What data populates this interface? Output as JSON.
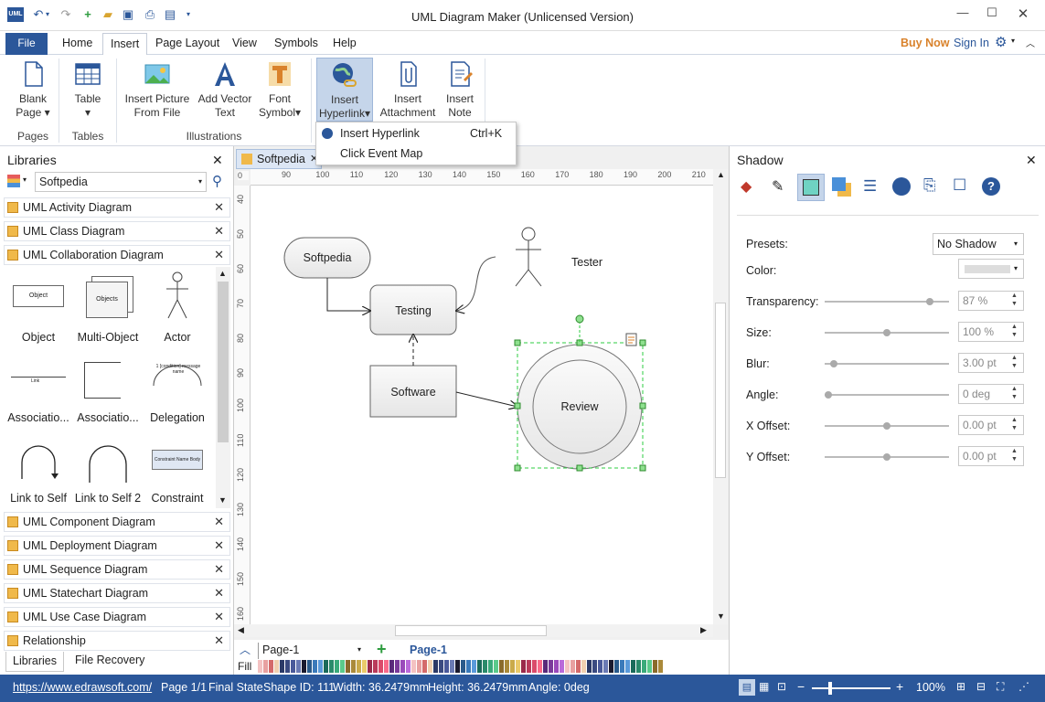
{
  "app": {
    "title": "UML Diagram Maker (Unlicensed Version)"
  },
  "menu": {
    "file": "File",
    "tabs": [
      "Home",
      "Insert",
      "Page Layout",
      "View",
      "Symbols",
      "Help"
    ],
    "buy_now": "Buy Now",
    "sign_in": "Sign In"
  },
  "ribbon": {
    "buttons": [
      {
        "line1": "Blank",
        "line2": "Page ▾"
      },
      {
        "line1": "Table",
        "line2": "▾"
      },
      {
        "line1": "Insert Picture",
        "line2": "From File"
      },
      {
        "line1": "Add Vector",
        "line2": "Text"
      },
      {
        "line1": "Font",
        "line2": "Symbol▾"
      },
      {
        "line1": "Insert",
        "line2": "Hyperlink▾"
      },
      {
        "line1": "Insert",
        "line2": "Attachment"
      },
      {
        "line1": "Insert",
        "line2": "Note"
      }
    ],
    "groups": [
      "Pages",
      "Tables",
      "Illustrations"
    ]
  },
  "hyperlink_menu": {
    "items": [
      {
        "label": "Insert Hyperlink",
        "shortcut": "Ctrl+K"
      },
      {
        "label": "Click Event Map",
        "shortcut": ""
      }
    ]
  },
  "libraries": {
    "title": "Libraries",
    "search_value": "Softpedia",
    "open": [
      "UML Activity Diagram",
      "UML Class Diagram",
      "UML Collaboration Diagram"
    ],
    "shapes": [
      "Object",
      "Multi-Object",
      "Actor",
      "Associatio...",
      "Associatio...",
      "Delegation",
      "Link to Self",
      "Link to Self 2",
      "Constraint"
    ],
    "shape_inner": {
      "object": "Object",
      "multi": "Objects",
      "link": "Link",
      "delegation": "1 [condition] message name",
      "constraint": "Constraint Name  Body"
    },
    "closed": [
      "UML Component Diagram",
      "UML Deployment Diagram",
      "UML Sequence Diagram",
      "UML Statechart Diagram",
      "UML Use Case Diagram",
      "Relationship"
    ],
    "bottom_tabs": [
      "Libraries",
      "File Recovery"
    ]
  },
  "document_tab": "Softpedia",
  "ruler": {
    "h": [
      "90",
      "100",
      "110",
      "120",
      "130",
      "140",
      "150",
      "160",
      "170",
      "180",
      "190",
      "200",
      "210"
    ],
    "v": [
      "40",
      "50",
      "60",
      "70",
      "80",
      "90",
      "100",
      "110",
      "120",
      "130",
      "140",
      "150",
      "160"
    ],
    "h_zero": "0"
  },
  "diagram": {
    "softpedia": "Softpedia",
    "testing": "Testing",
    "software": "Software",
    "review": "Review",
    "tester": "Tester"
  },
  "pages": {
    "current": "Page-1",
    "tab": "Page-1",
    "fill_label": "Fill"
  },
  "shadow_panel": {
    "title": "Shadow",
    "presets_label": "Presets:",
    "presets_value": "No Shadow",
    "rows": [
      {
        "label": "Color:",
        "value": "",
        "level": null
      },
      {
        "label": "Transparency:",
        "value": "87 %",
        "level": 0.87
      },
      {
        "label": "Size:",
        "value": "100 %",
        "level": 0.5
      },
      {
        "label": "Blur:",
        "value": "3.00 pt",
        "level": 0.05
      },
      {
        "label": "Angle:",
        "value": "0 deg",
        "level": 0.0
      },
      {
        "label": "X Offset:",
        "value": "0.00 pt",
        "level": 0.5
      },
      {
        "label": "Y Offset:",
        "value": "0.00 pt",
        "level": 0.5
      }
    ]
  },
  "status": {
    "url": "https://www.edrawsoft.com/",
    "page": "Page 1/1",
    "state": "Final State",
    "shape_id": "Shape ID: 111",
    "width": "Width: 36.2479mm",
    "height": "Height: 36.2479mm",
    "angle": "Angle: 0deg",
    "zoom": "100%"
  },
  "colors": {
    "accent": "#2b579a",
    "buy": "#d9822b",
    "selection": "#2ecc40"
  }
}
